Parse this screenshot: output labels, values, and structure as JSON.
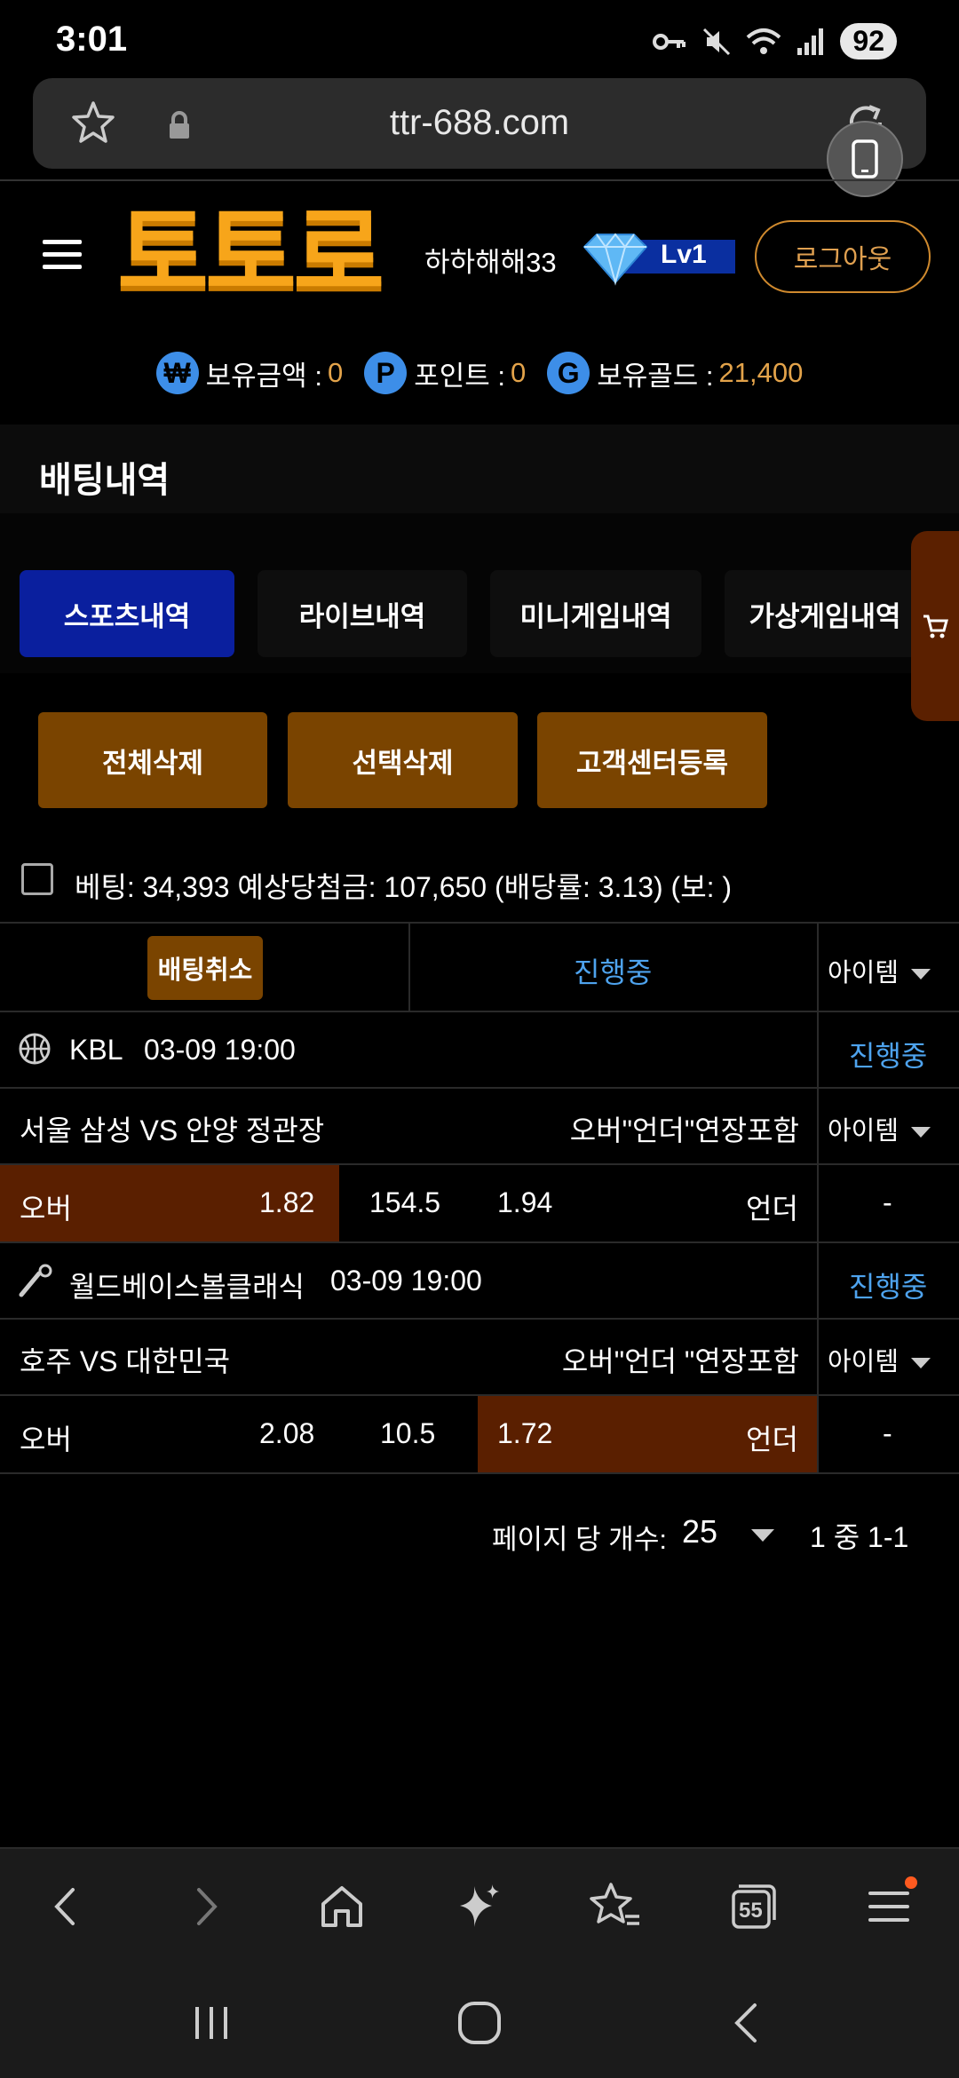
{
  "status_bar": {
    "time": "3:01",
    "battery": "92"
  },
  "browser": {
    "url": "ttr-688.com",
    "tab_count": "55"
  },
  "header": {
    "logo": "토토로",
    "username": "하하해해33",
    "level": "Lv1",
    "logout_label": "로그아웃"
  },
  "balances": [
    {
      "icon": "₩",
      "label": "보유금액 :",
      "value": "0"
    },
    {
      "icon": "P",
      "label": "포인트 :",
      "value": "0"
    },
    {
      "icon": "G",
      "label": "보유골드 :",
      "value": "21,400"
    }
  ],
  "page_title": "배팅내역",
  "tabs": [
    "스포츠내역",
    "라이브내역",
    "미니게임내역",
    "가상게임내역"
  ],
  "actions": [
    "전체삭제",
    "선택삭제",
    "고객센터등록"
  ],
  "summary": "베팅: 34,393 예상당첨금: 107,650 (배당률: 3.13) (보: )",
  "table": {
    "cancel_label": "배팅취소",
    "status_header": "진행중",
    "item_label": "아이템",
    "matches": [
      {
        "league": "KBL",
        "datetime": "03-09 19:00",
        "status": "진행중",
        "teams": "서울 삼성 VS 안양 정관장",
        "market": "오버\"언더\"연장포함",
        "item": "아이템",
        "over_label": "오버",
        "over_odds": "1.82",
        "line": "154.5",
        "under_odds": "1.94",
        "under_label": "언더",
        "result": "-"
      },
      {
        "league": "월드베이스볼클래식",
        "datetime": "03-09 19:00",
        "status": "진행중",
        "teams": "호주 VS 대한민국",
        "market": "오버\"언더 \"연장포함",
        "item": "아이템",
        "over_label": "오버",
        "over_odds": "2.08",
        "line": "10.5",
        "under_odds": "1.72",
        "under_label": "언더",
        "result": "-"
      }
    ]
  },
  "pagination": {
    "label": "페이지 당 개수:",
    "page_size": "25",
    "range": "1 중 1-1"
  },
  "colors": {
    "accent_brown": "#7a4400",
    "active_tab": "#0a1f9e",
    "highlight": "#5a1f00",
    "status_blue": "#4ea3ee",
    "gold": "#e3a34a"
  }
}
